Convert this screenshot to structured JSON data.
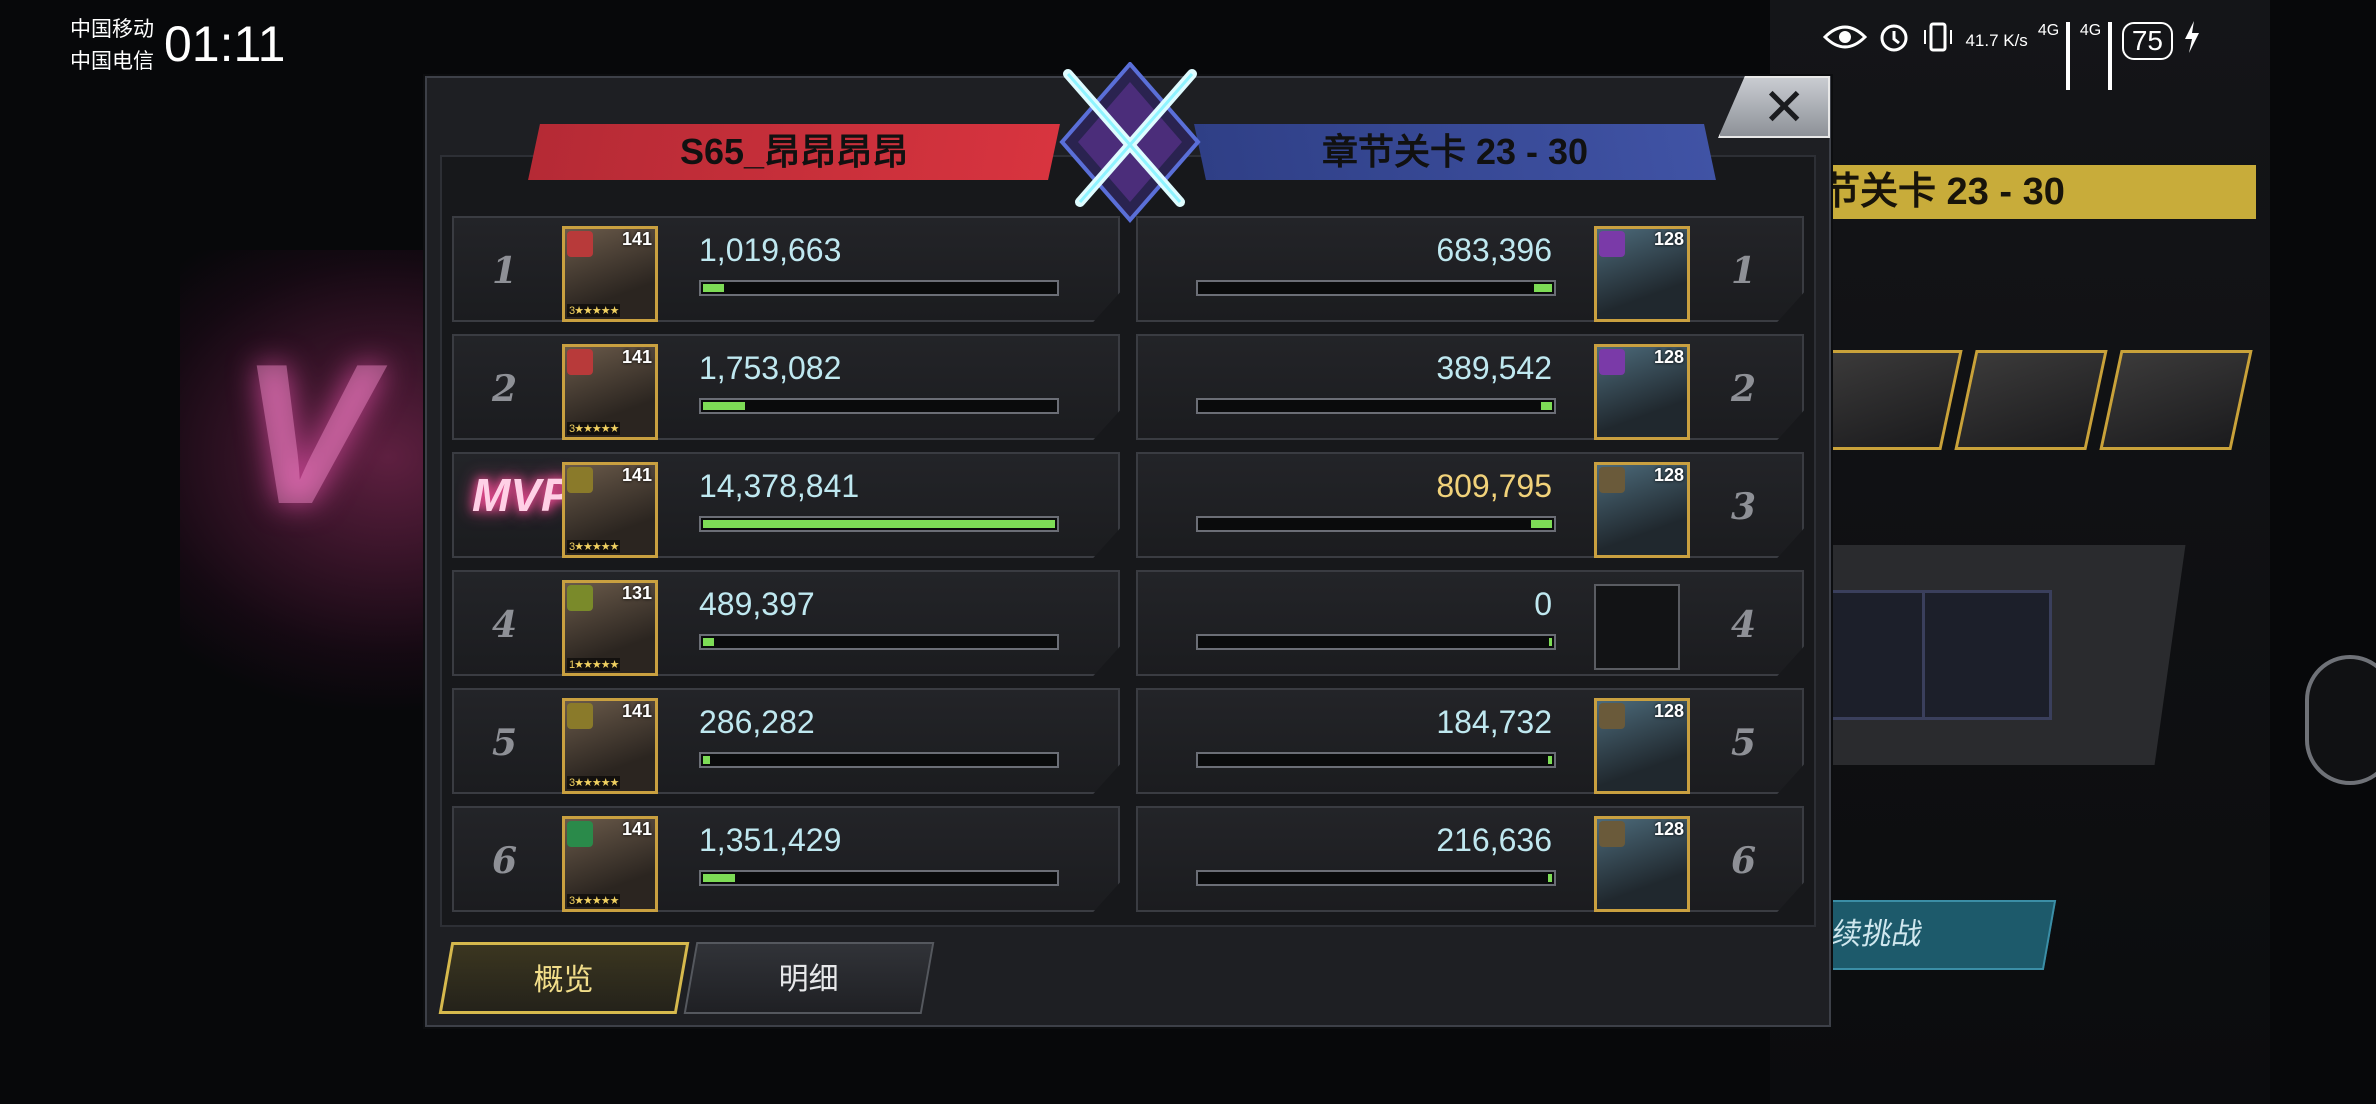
{
  "status_bar": {
    "carrier1": "中国移动",
    "carrier2": "中国电信",
    "time": "01:11",
    "net_speed": "41.7 K/s",
    "net1": "4G",
    "net2": "4G",
    "battery": "75"
  },
  "background": {
    "stage_label": "节关卡 23 - 30",
    "side_button": "续挑战"
  },
  "dialog": {
    "left_team": "S65_昂昂昂昂",
    "right_team": "章节关卡 23 - 30",
    "mvp_label": "MVP",
    "rows": [
      {
        "rank": "1",
        "left": {
          "level": "141",
          "stars": "3★★★★★",
          "score": "1,019,663",
          "fill": 0.06
        },
        "right": {
          "level": "128",
          "score": "683,396",
          "fill": 0.05
        }
      },
      {
        "rank": "2",
        "left": {
          "level": "141",
          "stars": "3★★★★★",
          "score": "1,753,082",
          "fill": 0.12
        },
        "right": {
          "level": "128",
          "score": "389,542",
          "fill": 0.03
        }
      },
      {
        "rank": "3",
        "left": {
          "level": "141",
          "stars": "3★★★★★",
          "score": "14,378,841",
          "fill": 1.0
        },
        "right": {
          "level": "128",
          "score": "809,795",
          "fill": 0.06
        }
      },
      {
        "rank": "4",
        "left": {
          "level": "131",
          "stars": "1★★★★★",
          "score": "489,397",
          "fill": 0.03
        },
        "right": {
          "level": "",
          "score": "0",
          "fill": 0.0
        }
      },
      {
        "rank": "5",
        "left": {
          "level": "141",
          "stars": "3★★★★★",
          "score": "286,282",
          "fill": 0.02
        },
        "right": {
          "level": "128",
          "score": "184,732",
          "fill": 0.01
        }
      },
      {
        "rank": "6",
        "left": {
          "level": "141",
          "stars": "3★★★★★",
          "score": "1,351,429",
          "fill": 0.09
        },
        "right": {
          "level": "128",
          "score": "216,636",
          "fill": 0.01
        }
      }
    ],
    "tabs": [
      "概览",
      "明细"
    ]
  },
  "colors": {
    "bar_fill": "#7ddc56",
    "score": "#bfe8f0",
    "gold_score": "#f1d27a",
    "left_banner": "#d8343f",
    "right_banner": "#4053a5"
  },
  "icons": [
    "close-icon",
    "crossed-swords-icon",
    "mvp-icon",
    "eye-icon",
    "alarm-icon",
    "vibrate-icon",
    "signal-icon",
    "charging-icon"
  ]
}
